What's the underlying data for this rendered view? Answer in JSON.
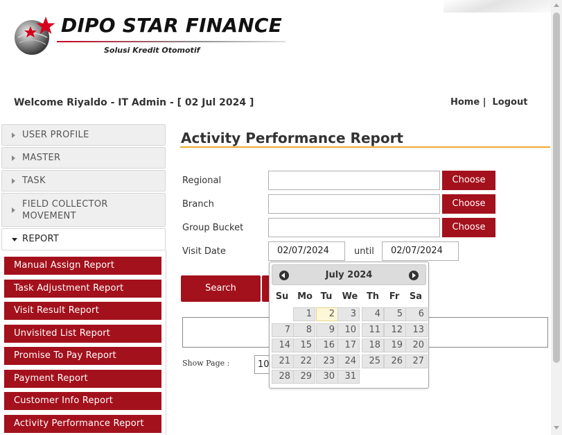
{
  "logo": {
    "brand": "DIPO STAR FINANCE",
    "tagline": "Solusi Kredit Otomotif",
    "icon": "star-globe-icon"
  },
  "header": {
    "welcome": "Welcome Riyaldo - IT Admin - [ 02 Jul 2024 ]",
    "home": "Home |",
    "logout": "Logout"
  },
  "sidebar": {
    "items": [
      {
        "label": "USER PROFILE"
      },
      {
        "label": "MASTER"
      },
      {
        "label": "TASK"
      },
      {
        "label": "FIELD COLLECTOR MOVEMENT"
      },
      {
        "label": "REPORT"
      }
    ],
    "report_items": [
      {
        "label": "Manual Assign Report"
      },
      {
        "label": "Task Adjustment Report"
      },
      {
        "label": "Visit Result Report"
      },
      {
        "label": "Unvisited List Report"
      },
      {
        "label": "Promise To Pay Report"
      },
      {
        "label": "Payment Report"
      },
      {
        "label": "Customer Info Report"
      },
      {
        "label": "Activity Performance Report"
      }
    ]
  },
  "main": {
    "title": "Activity Performance Report",
    "form": {
      "regional_label": "Regional",
      "branch_label": "Branch",
      "group_bucket_label": "Group Bucket",
      "visit_date_label": "Visit Date",
      "choose_label": "Choose",
      "date_from": "02/07/2024",
      "until_label": "until",
      "date_to": "02/07/2024"
    },
    "search_label": "Search",
    "show_page_label": "Show Page :",
    "page_size": "10"
  },
  "calendar": {
    "title": "July 2024",
    "weekdays": [
      "Su",
      "Mo",
      "Tu",
      "We",
      "Th",
      "Fr",
      "Sa"
    ],
    "first_weekday": 1,
    "days_in_month": 31,
    "highlight_day": 2
  },
  "colors": {
    "accent_red": "#a3111c",
    "title_underline": "#f0a830"
  }
}
